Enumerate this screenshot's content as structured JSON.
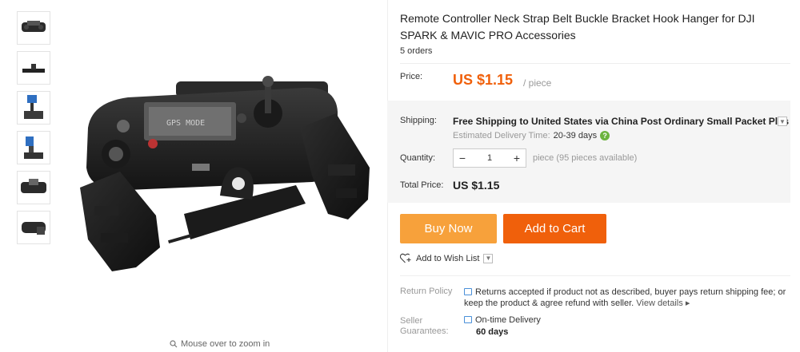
{
  "gallery": {
    "thumbnails": [
      "controller-front",
      "strap-hook-side",
      "drone-hanging",
      "blue-bracket",
      "controller-with-hook",
      "controller-angle"
    ],
    "zoom_hint": "Mouse over to zoom in",
    "main_image_icon": "remote-controller-with-bracket"
  },
  "product": {
    "title": "Remote Controller Neck Strap Belt Buckle Bracket Hook Hanger for DJI SPARK & MAVIC PRO Accessories",
    "orders": "5 orders"
  },
  "price": {
    "label": "Price:",
    "value": "US $1.15",
    "unit": "/ piece",
    "color": "#f0600b"
  },
  "shipping": {
    "label": "Shipping:",
    "method": "Free Shipping to United States via China Post Ordinary Small Packet Plus",
    "estimate_label": "Estimated Delivery Time:",
    "estimate_value": "20-39 days"
  },
  "quantity": {
    "label": "Quantity:",
    "value": "1",
    "minus": "−",
    "plus": "+",
    "note": "piece (95 pieces available)"
  },
  "total": {
    "label": "Total Price:",
    "value": "US $1.15"
  },
  "actions": {
    "buy_now": "Buy Now",
    "add_to_cart": "Add to Cart",
    "buy_color": "#f7a13b",
    "cart_color": "#f0600b",
    "wish_list": "Add to Wish List"
  },
  "policy": {
    "return_label": "Return Policy",
    "return_text": "Returns accepted if product not as described, buyer pays return shipping fee; or keep the product & agree refund with seller.",
    "view_details": "View details",
    "seller_label_1": "Seller",
    "seller_label_2": "Guarantees:",
    "delivery_title": "On-time Delivery",
    "delivery_days": "60 days"
  }
}
